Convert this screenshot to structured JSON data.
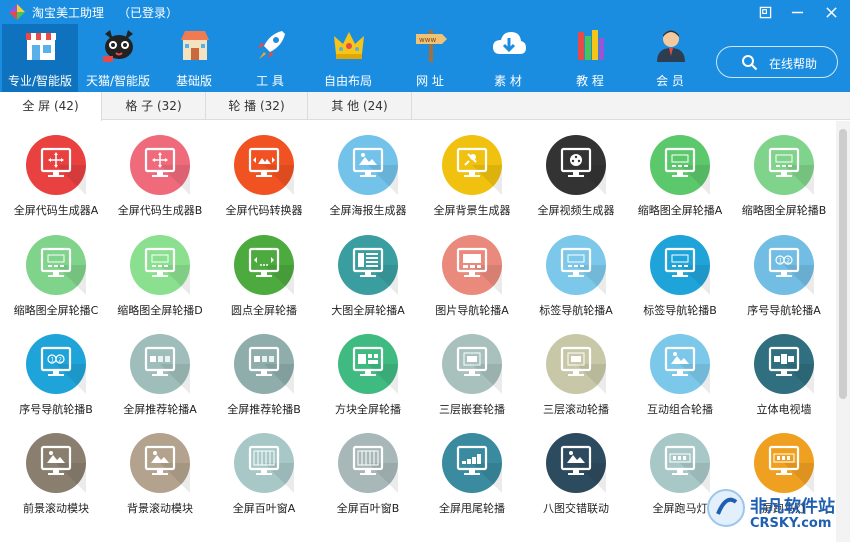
{
  "app": {
    "title": "淘宝美工助理",
    "login_status": "（已登录）"
  },
  "window": {
    "restore_icon": "restore-icon",
    "minimize_icon": "minimize-icon",
    "close_icon": "close-icon"
  },
  "colors": {
    "topbar": "#1b8de0",
    "active_nav": "#0f72bf"
  },
  "nav": [
    {
      "label": "专业/智能版",
      "icon": "storefront-icon",
      "active": true
    },
    {
      "label": "天猫/智能版",
      "icon": "tmall-cat-icon"
    },
    {
      "label": "基础版",
      "icon": "shop-icon"
    },
    {
      "label": "工 具",
      "icon": "rocket-icon"
    },
    {
      "label": "自由布局",
      "icon": "crown-icon"
    },
    {
      "label": "网 址",
      "icon": "signpost-icon"
    },
    {
      "label": "素 材",
      "icon": "cloud-download-icon"
    },
    {
      "label": "教 程",
      "icon": "books-icon"
    },
    {
      "label": "会 员",
      "icon": "member-icon"
    }
  ],
  "help": {
    "label": "在线帮助",
    "icon": "search-icon"
  },
  "tabs": [
    {
      "label": "全 屏 (42)",
      "active": true
    },
    {
      "label": "格 子 (32)"
    },
    {
      "label": "轮 播 (32)"
    },
    {
      "label": "其 他 (24)"
    }
  ],
  "tiles": [
    {
      "label": "全屏代码生成器A",
      "color": "#e8413f",
      "glyph": "move"
    },
    {
      "label": "全屏代码生成器B",
      "color": "#ef6b7c",
      "glyph": "move"
    },
    {
      "label": "全屏代码转换器",
      "color": "#f15222",
      "glyph": "image-arrows"
    },
    {
      "label": "全屏海报生成器",
      "color": "#72c2ea",
      "glyph": "image"
    },
    {
      "label": "全屏背景生成器",
      "color": "#f0c20f",
      "glyph": "pin"
    },
    {
      "label": "全屏视频生成器",
      "color": "#333333",
      "glyph": "film"
    },
    {
      "label": "缩略图全屏轮播A",
      "color": "#5cc86c",
      "glyph": "slides"
    },
    {
      "label": "缩略图全屏轮播B",
      "color": "#7fd38a",
      "glyph": "slides"
    },
    {
      "label": "缩略图全屏轮播C",
      "color": "#7fd38a",
      "glyph": "slides"
    },
    {
      "label": "缩略图全屏轮播D",
      "color": "#8ae08f",
      "glyph": "slides"
    },
    {
      "label": "圆点全屏轮播",
      "color": "#4caa3e",
      "glyph": "dots"
    },
    {
      "label": "大图全屏轮播A",
      "color": "#3a9ea1",
      "glyph": "list"
    },
    {
      "label": "图片导航轮播A",
      "color": "#ea8a7c",
      "glyph": "imgnav"
    },
    {
      "label": "标签导航轮播A",
      "color": "#7cc8ea",
      "glyph": "slides"
    },
    {
      "label": "标签导航轮播B",
      "color": "#1fa4d9",
      "glyph": "slides"
    },
    {
      "label": "序号导航轮播A",
      "color": "#72bde3",
      "glyph": "numbers"
    },
    {
      "label": "序号导航轮播B",
      "color": "#1fa4d9",
      "glyph": "numbers"
    },
    {
      "label": "全屏推荐轮播A",
      "color": "#9fbebb",
      "glyph": "recommend"
    },
    {
      "label": "全屏推荐轮播B",
      "color": "#8eadab",
      "glyph": "recommend"
    },
    {
      "label": "方块全屏轮播",
      "color": "#3fba80",
      "glyph": "blocks"
    },
    {
      "label": "三层嵌套轮播",
      "color": "#a8c1bd",
      "glyph": "nested"
    },
    {
      "label": "三层滚动轮播",
      "color": "#c8c8a8",
      "glyph": "nested"
    },
    {
      "label": "互动组合轮播",
      "color": "#7cc8ea",
      "glyph": "image"
    },
    {
      "label": "立体电视墙",
      "color": "#2f6f7f",
      "glyph": "tvwall"
    },
    {
      "label": "前景滚动模块",
      "color": "#8a7f6f",
      "glyph": "image"
    },
    {
      "label": "背景滚动模块",
      "color": "#b3a38e",
      "glyph": "image"
    },
    {
      "label": "全屏百叶窗A",
      "color": "#a8c8c8",
      "glyph": "blinds"
    },
    {
      "label": "全屏百叶窗B",
      "color": "#a8b8b8",
      "glyph": "blinds"
    },
    {
      "label": "全屏甩尾轮播",
      "color": "#3a8aa0",
      "glyph": "bars"
    },
    {
      "label": "八图交错联动",
      "color": "#2d4b5f",
      "glyph": "image"
    },
    {
      "label": "全屏跑马灯",
      "color": "#a8c8c8",
      "glyph": "marquee"
    },
    {
      "label": "屏跑马灯",
      "color": "#f0a020",
      "glyph": "marquee"
    }
  ],
  "watermark": {
    "main": "非凡软件站",
    "sub": "CRSKY.com"
  }
}
